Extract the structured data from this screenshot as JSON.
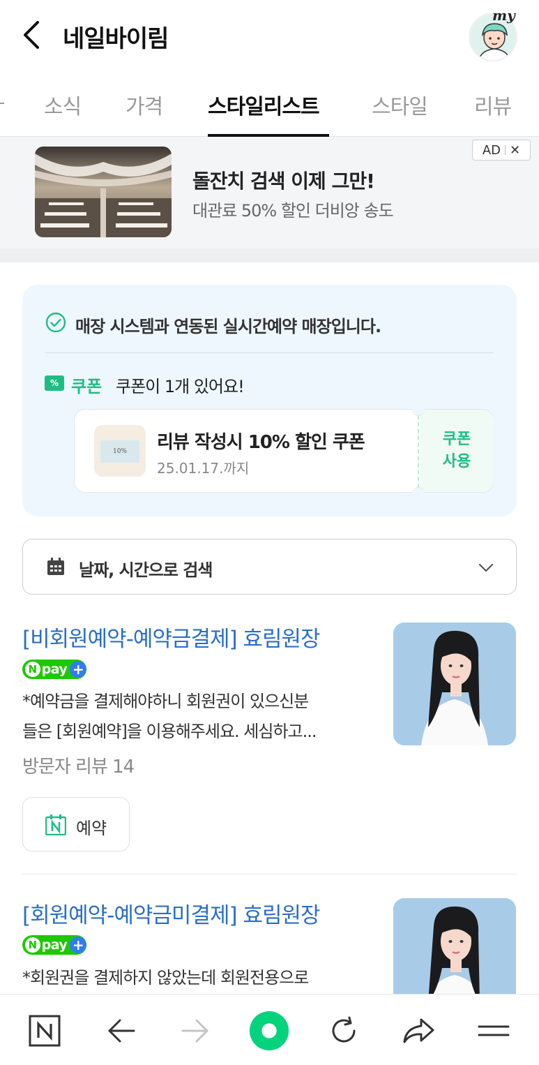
{
  "header": {
    "title": "네일바이림",
    "my_label": "my"
  },
  "tabs": [
    {
      "label": "소식"
    },
    {
      "label": "가격"
    },
    {
      "label": "스타일리스트"
    },
    {
      "label": "스타일"
    },
    {
      "label": "리뷰"
    }
  ],
  "active_tab": "스타일리스트",
  "ad": {
    "title": "돌잔치 검색 이제 그만!",
    "subtitle": "대관료 50% 할인 더비앙 송도",
    "badge": "AD",
    "close": "✕"
  },
  "info": {
    "realtime_text": "매장 시스템과 연동된 실시간예약 매장입니다.",
    "coupon_icon": "%",
    "coupon_label": "쿠폰",
    "coupon_count_text": "쿠폰이 1개 있어요!",
    "coupon": {
      "name": "리뷰 작성시 10% 할인 쿠폰",
      "expires": "25.01.17.까지",
      "thumb_text": "10%",
      "use_line1": "쿠폰",
      "use_line2": "사용"
    }
  },
  "search": {
    "label": "날짜, 시간으로 검색"
  },
  "items": [
    {
      "title": "[비회원예약-예약금결제] 효림원장",
      "desc_line1": "*예약금을 결제해야하니 회원권이 있으신분",
      "desc_line2": "들은 [회원예약]을 이용해주세요. 세심하고...",
      "review": "방문자 리뷰 14",
      "book_label": "예약"
    },
    {
      "title": "[회원예약-예약금미결제] 효림원장",
      "desc_line1": "*회원권을 결제하지 않았는데 회원전용으로"
    }
  ],
  "npay": {
    "n": "N",
    "pay": "pay",
    "plus": "+"
  },
  "colors": {
    "link_blue": "#2a6fc9",
    "green": "#1fbd84",
    "npay_green": "#1ec800",
    "info_bg": "#eef7fd"
  },
  "icons": {
    "back": "chevron-left-icon",
    "check": "check-circle-icon",
    "calendar": "calendar-icon",
    "chevron": "chevron-down-icon",
    "naver": "naver-n-icon",
    "arrow_left": "arrow-left-icon",
    "arrow_right": "arrow-right-icon",
    "home": "green-dot-icon",
    "refresh": "refresh-icon",
    "share": "share-icon",
    "menu": "menu-icon"
  }
}
